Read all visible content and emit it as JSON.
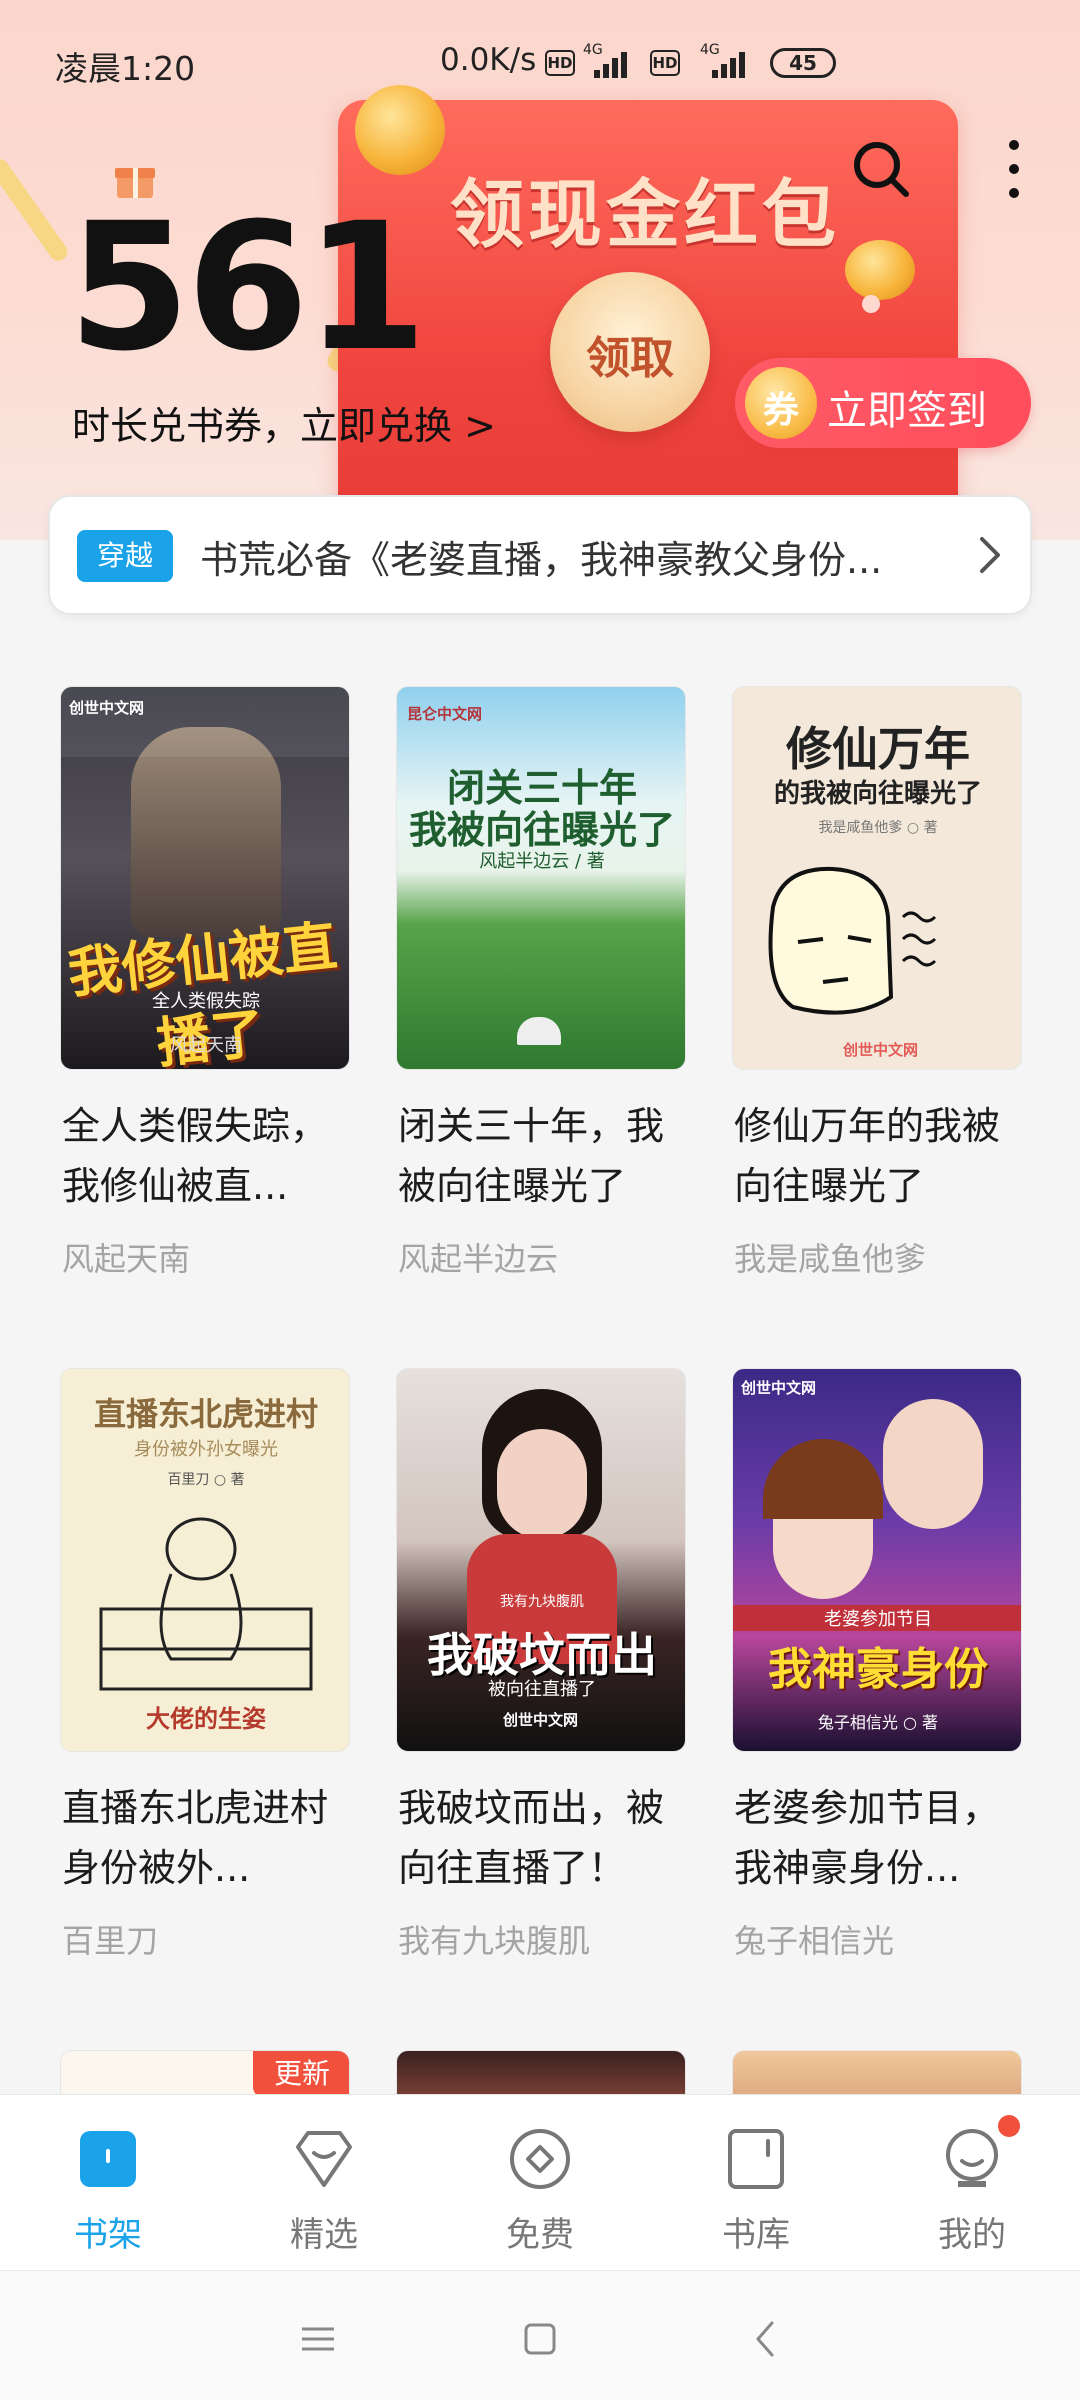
{
  "status_bar": {
    "time": "凌晨1:20",
    "network_speed": "0.0K/s",
    "hd_label": "HD",
    "network_type": "4G",
    "battery": "45"
  },
  "header": {
    "banner_title": "领现金红包",
    "claim_label": "领取",
    "duration_count": "561",
    "exchange_text": "时长兑书券，立即兑换 >",
    "checkin_coin_label": "券",
    "checkin_label": "立即签到",
    "icons": [
      "gift-icon",
      "search-icon",
      "more-icon"
    ]
  },
  "notice": {
    "tag": "穿越",
    "text": "书荒必备《老婆直播，我神豪教父身份...",
    "chevron_icon": "chevron-right-icon"
  },
  "books": [
    {
      "title": "全人类假失踪，我修仙被直...",
      "author": "风起天南",
      "cover_title": "我修仙被直播了",
      "cover_subtitle": "全人类假失踪",
      "cover_author": "风起天南",
      "cover_publisher": "创世中文网",
      "colors": [
        "#2b2b33",
        "#5e5a63"
      ]
    },
    {
      "title": "闭关三十年，我被向往曝光了",
      "author": "风起半边云",
      "cover_title": "闭关三十年",
      "cover_subtitle": "我被向往曝光了",
      "cover_author": "风起半边云 / 著",
      "cover_publisher": "昆仑中文网",
      "colors": [
        "#63b8e0",
        "#2f8a3c"
      ]
    },
    {
      "title": "修仙万年的我被向往曝光了",
      "author": "我是咸鱼他爹",
      "cover_title": "修仙万年",
      "cover_subtitle": "的我被向往曝光了",
      "cover_author": "我是咸鱼他爹 ○ 著",
      "cover_publisher": "创世中文网",
      "colors": [
        "#f4eadc",
        "#efe3d2"
      ]
    },
    {
      "title": "直播东北虎进村身份被外...",
      "author": "百里刀",
      "cover_title": "直播东北虎进村",
      "cover_subtitle": "身份被外孙女曝光",
      "cover_author": "百里刀 ○ 著",
      "cover_publisher": "大佬的生姿",
      "colors": [
        "#f6efd7",
        "#f3e9cc"
      ]
    },
    {
      "title": "我破坟而出，被向往直播了！",
      "author": "我有九块腹肌",
      "cover_title": "我破坟而出",
      "cover_subtitle": "被向往直播了",
      "cover_author": "我有九块腹肌",
      "cover_publisher": "创世中文网",
      "colors": [
        "#d9d3cf",
        "#1b1b1b"
      ]
    },
    {
      "title": "老婆参加节目，我神豪身份...",
      "author": "兔子相信光",
      "cover_title": "我神豪身份",
      "cover_subtitle": "老婆参加节目",
      "cover_author": "兔子相信光 ○ 著",
      "cover_publisher": "创世中文网",
      "colors": [
        "#3a2a7a",
        "#9a3a9c"
      ]
    }
  ],
  "partial_books": {
    "update_badge": "更新"
  },
  "tabbar": {
    "tabs": [
      {
        "label": "书架",
        "icon": "bookshelf-icon",
        "active": true
      },
      {
        "label": "精选",
        "icon": "diamond-icon",
        "active": false
      },
      {
        "label": "免费",
        "icon": "free-icon",
        "active": false
      },
      {
        "label": "书库",
        "icon": "library-icon",
        "active": false
      },
      {
        "label": "我的",
        "icon": "profile-icon",
        "active": false,
        "has_dot": true
      }
    ]
  },
  "navbar": {
    "buttons": [
      "menu-icon",
      "home-icon",
      "back-icon"
    ]
  },
  "colors": {
    "accent": "#1aa3e8",
    "red": "#f0503c",
    "header_bg": "#fbd6cd"
  }
}
